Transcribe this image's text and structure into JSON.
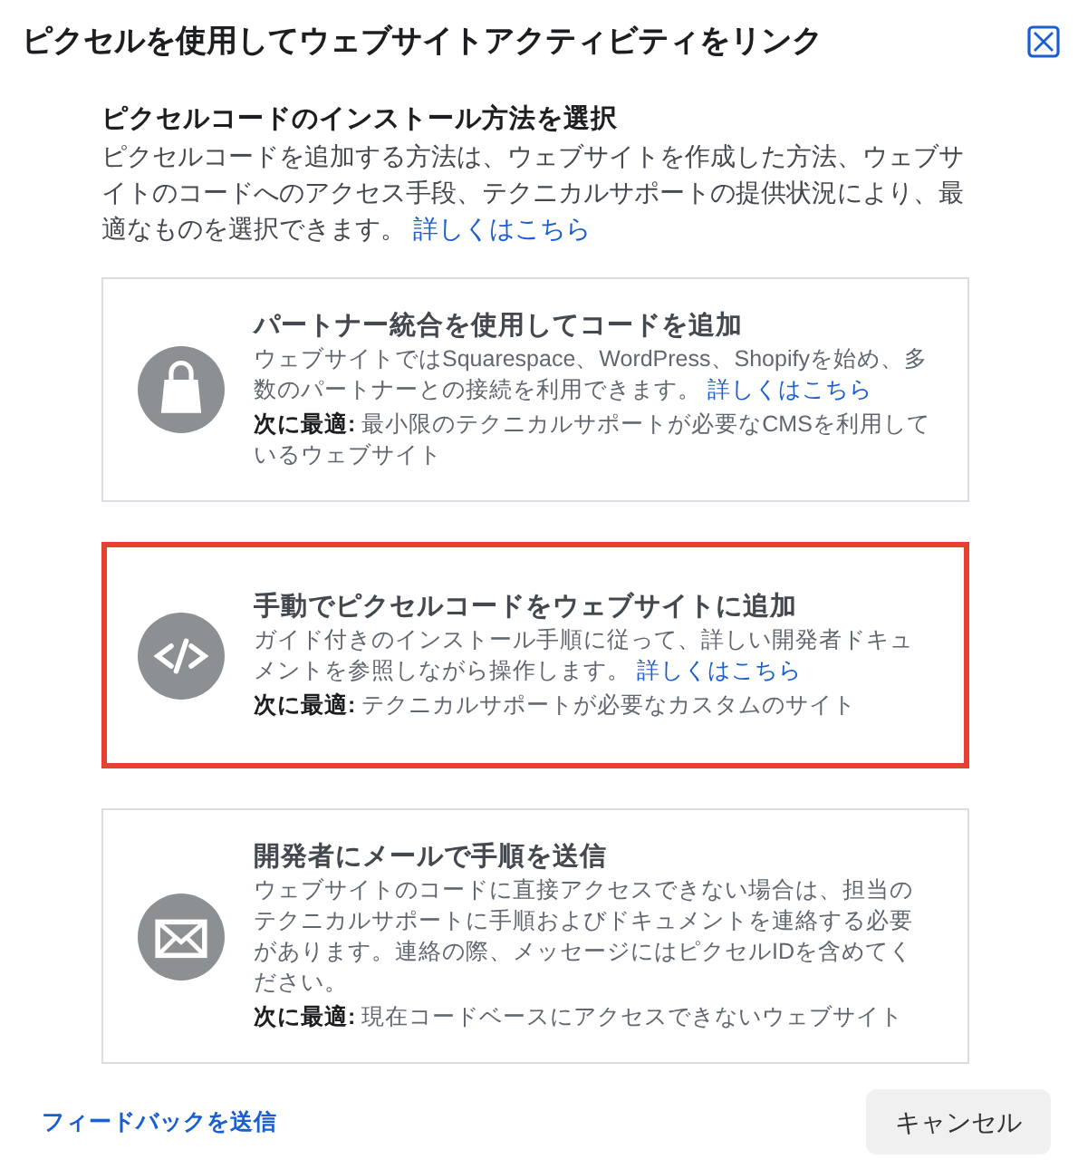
{
  "dialog": {
    "title": "ピクセルを使用してウェブサイトアクティビティをリンク"
  },
  "intro": {
    "heading": "ピクセルコードのインストール方法を選択",
    "text": "ピクセルコードを追加する方法は、ウェブサイトを作成した方法、ウェブサイトのコードへのアクセス手段、テクニカルサポートの提供状況により、最適なものを選択できます。",
    "link": "詳しくはこちら"
  },
  "options": [
    {
      "kind": "bag",
      "title": "パートナー統合を使用してコードを追加",
      "description": "ウェブサイトではSquarespace、WordPress、Shopifyを始め、多数のパートナーとの接続を利用できます。",
      "link": "詳しくはこちら",
      "best_for_label": "次に最適:",
      "best_for": "最小限のテクニカルサポートが必要なCMSを利用しているウェブサイト",
      "selected": false
    },
    {
      "kind": "code",
      "title": "手動でピクセルコードをウェブサイトに追加",
      "description": "ガイド付きのインストール手順に従って、詳しい開発者ドキュメントを参照しながら操作します。",
      "link": "詳しくはこちら",
      "best_for_label": "次に最適:",
      "best_for": "テクニカルサポートが必要なカスタムのサイト",
      "selected": true
    },
    {
      "kind": "mail",
      "title": "開発者にメールで手順を送信",
      "description": "ウェブサイトのコードに直接アクセスできない場合は、担当のテクニカルサポートに手順およびドキュメントを連絡する必要があります。連絡の際、メッセージにはピクセルIDを含めてください。",
      "best_for_label": "次に最適:",
      "best_for": "現在コードベースにアクセスできないウェブサイト",
      "selected": false
    }
  ],
  "footer": {
    "feedback_link": "フィードバックを送信",
    "cancel_button": "キャンセル"
  }
}
